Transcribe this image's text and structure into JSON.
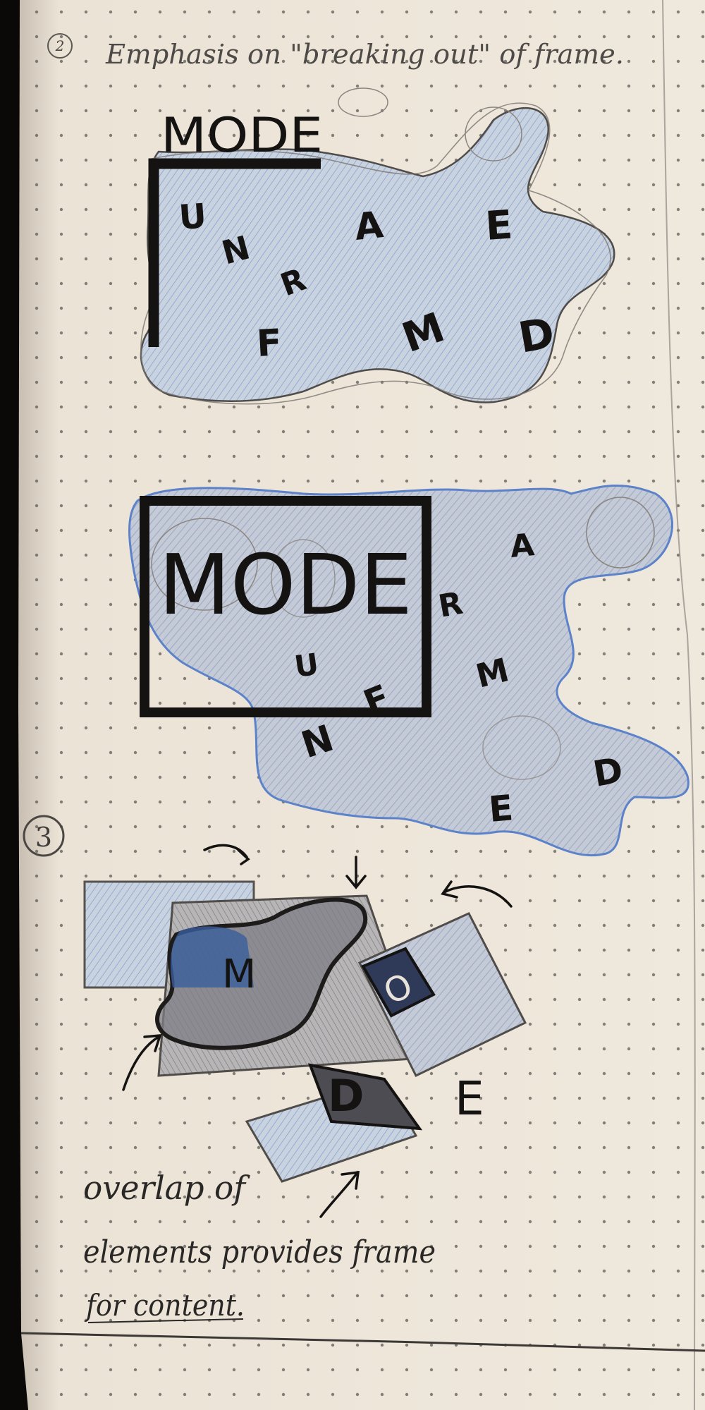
{
  "photo": {
    "subject": "sketchbook page",
    "colors": {
      "paper": "#efe8dc",
      "paper_shadow": "#d9d0c2",
      "pencil": "#6d6a66",
      "ink": "#141312",
      "blue_shade": "#a9bfe0",
      "blue_edge": "#5c82c9",
      "dark_blue": "#3a5e9c",
      "background": "#0b0908"
    }
  },
  "section2": {
    "number": "2",
    "heading": "Emphasis on \"breaking out\" of frame.",
    "sketch_a": {
      "label": "MODE",
      "letters": [
        "U",
        "N",
        "R",
        "A",
        "E",
        "F",
        "M",
        "D"
      ]
    },
    "sketch_b": {
      "label": "MODE",
      "letters": [
        "A",
        "R",
        "U",
        "M",
        "F",
        "N",
        "D",
        "E"
      ]
    }
  },
  "section3": {
    "number": "3",
    "letters": [
      "M",
      "O",
      "D",
      "E"
    ],
    "note_line1": "overlap of",
    "note_line2": "elements provides frame",
    "note_line3": "for content."
  }
}
